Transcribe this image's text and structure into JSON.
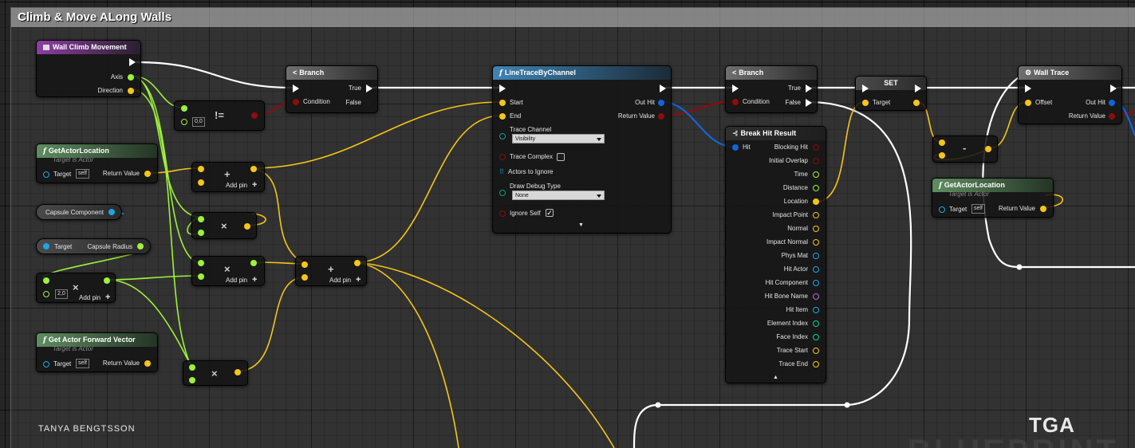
{
  "comment_title": "Climb & Move ALong Walls",
  "watermark_left": "TANYA BENGTSSON",
  "watermark_right": "TGA",
  "background_text": "BLUEPRINT",
  "nodes": {
    "wall_climb": {
      "title": "Wall Climb Movement",
      "axis": "Axis",
      "direction": "Direction"
    },
    "neq": {
      "op": "!=",
      "value": "0,0"
    },
    "get_actor_location_1": {
      "title": "GetActorLocation",
      "subtitle": "Target is Actor",
      "target": "Target",
      "self": "self",
      "return": "Return Value"
    },
    "capsule_component": {
      "label": "Capsule Component"
    },
    "capsule_radius": {
      "target": "Target",
      "output": "Capsule Radius"
    },
    "add_1": {
      "op": "+",
      "add_pin": "Add pin"
    },
    "mul_1": {
      "op": "×"
    },
    "mul_2": {
      "op": "×",
      "add_pin": "Add pin"
    },
    "mul_3": {
      "op": "×",
      "value": "2,0",
      "add_pin": "Add pin"
    },
    "add_2": {
      "op": "+",
      "add_pin": "Add pin"
    },
    "forward_vector": {
      "title": "Get Actor Forward Vector",
      "subtitle": "Target is Actor",
      "target": "Target",
      "self": "self",
      "return": "Return Value"
    },
    "mul_4": {
      "op": "×"
    },
    "branch_1": {
      "title": "Branch",
      "true": "True",
      "false": "False",
      "condition": "Condition"
    },
    "line_trace": {
      "title": "LineTraceByChannel",
      "start": "Start",
      "end": "End",
      "out_hit": "Out Hit",
      "return": "Return Value",
      "trace_channel": "Trace Channel",
      "trace_channel_value": "Visibility",
      "trace_complex": "Trace Complex",
      "actors_to_ignore": "Actors to Ignore",
      "draw_debug_type": "Draw Debug Type",
      "draw_debug_value": "None",
      "ignore_self": "Ignore Self"
    },
    "branch_2": {
      "title": "Branch",
      "true": "True",
      "false": "False",
      "condition": "Condition"
    },
    "break_hit": {
      "title": "Break Hit Result",
      "hit": "Hit",
      "outputs": [
        "Blocking Hit",
        "Initial Overlap",
        "Time",
        "Distance",
        "Location",
        "Impact Point",
        "Normal",
        "Impact Normal",
        "Phys Mat",
        "Hit Actor",
        "Hit Component",
        "Hit Bone Name",
        "Hit Item",
        "Element Index",
        "Face Index",
        "Trace Start",
        "Trace End"
      ]
    },
    "set": {
      "title": "SET",
      "target": "Target"
    },
    "subtract": {
      "op": "-"
    },
    "get_actor_location_2": {
      "title": "GetActorLocation",
      "subtitle": "Target is Actor",
      "target": "Target",
      "self": "self",
      "return": "Return Value"
    },
    "wall_trace": {
      "title": "Wall Trace",
      "offset": "Offset",
      "out_hit": "Out Hit",
      "return": "Return Value"
    }
  },
  "colors": {
    "exec": "#ffffff",
    "vector": "#f5c518",
    "float": "#9cf23a",
    "bool": "#8c0d0d",
    "struct": "#0a5fd6",
    "object": "#1aa7e0"
  }
}
